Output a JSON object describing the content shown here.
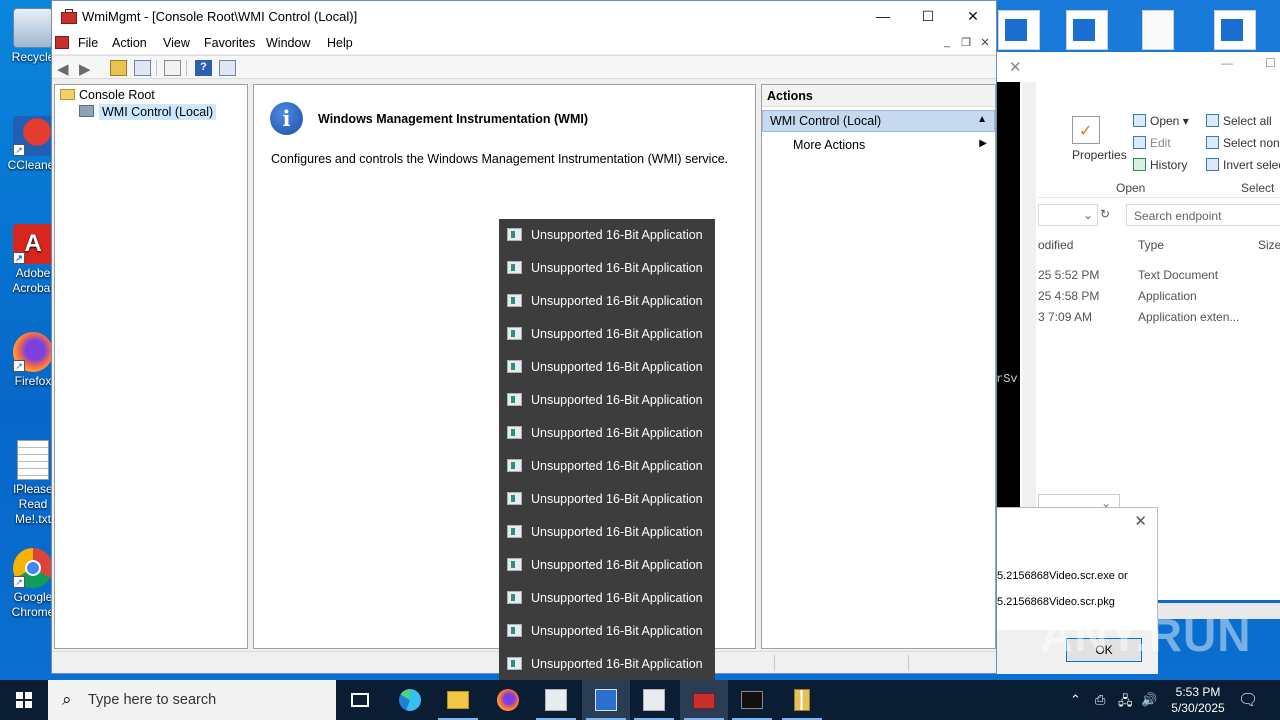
{
  "desktop": {
    "icons": [
      {
        "label": "Recycle",
        "name": "recycle-bin"
      },
      {
        "label": "CCleaner",
        "name": "ccleaner"
      },
      {
        "label": "Adobe Acrobat",
        "name": "adobe-acrobat"
      },
      {
        "label": "Firefox",
        "name": "firefox"
      },
      {
        "label": "lPlease Read Me!.txt",
        "name": "readme-text-file"
      },
      {
        "label": "Google Chrome",
        "name": "google-chrome"
      }
    ]
  },
  "mmc": {
    "title": "WmiMgmt - [Console Root\\WMI Control (Local)]",
    "caption": {
      "minimize": "—",
      "maximize": "☐",
      "close": "✕"
    },
    "menu": [
      "File",
      "Action",
      "View",
      "Favorites",
      "Window",
      "Help"
    ],
    "tree": {
      "root": "Console Root",
      "child": "WMI Control (Local)"
    },
    "center": {
      "heading": "Windows Management Instrumentation (WMI)",
      "description": "Configures and controls the Windows Management Instrumentation (WMI) service."
    },
    "actions": {
      "header": "Actions",
      "group": "WMI Control (Local)",
      "more": "More Actions"
    }
  },
  "popup": {
    "items": [
      "Unsupported 16-Bit Application",
      "Unsupported 16-Bit Application",
      "Unsupported 16-Bit Application",
      "Unsupported 16-Bit Application",
      "Unsupported 16-Bit Application",
      "Unsupported 16-Bit Application",
      "Unsupported 16-Bit Application",
      "Unsupported 16-Bit Application",
      "Unsupported 16-Bit Application",
      "Unsupported 16-Bit Application",
      "Unsupported 16-Bit Application",
      "Unsupported 16-Bit Application",
      "Unsupported 16-Bit Application",
      "Unsupported 16-Bit Application"
    ]
  },
  "explorer": {
    "ribbon": {
      "properties": "Properties",
      "open": "Open",
      "edit": "Edit",
      "history": "History",
      "open_group": "Open",
      "select_all": "Select all",
      "select_none": "Select non",
      "invert": "Invert selec",
      "select_group": "Select"
    },
    "search_placeholder": "Search endpoint",
    "columns": {
      "modified": "odified",
      "type": "Type",
      "size": "Size"
    },
    "rows": [
      {
        "date": "25 5:52 PM",
        "type": "Text Document"
      },
      {
        "date": "25 4:58 PM",
        "type": "Application"
      },
      {
        "date": "3 7:09 AM",
        "type": "Application exten..."
      }
    ],
    "console_fragment": "rSv"
  },
  "dialog": {
    "line1": "5.2156868Video.scr.exe or",
    "line2": "5.2156868Video.scr.pkg",
    "ok": "OK"
  },
  "watermark": "ANY.RUN",
  "taskbar": {
    "search_placeholder": "Type here to search",
    "time": "5:53 PM",
    "date": "5/30/2025"
  },
  "colors": {
    "accent": "#0078d7",
    "popup_bg": "#3d3d3d",
    "actions_group": "#c6d9ef",
    "taskbar": "#0b1d33"
  }
}
